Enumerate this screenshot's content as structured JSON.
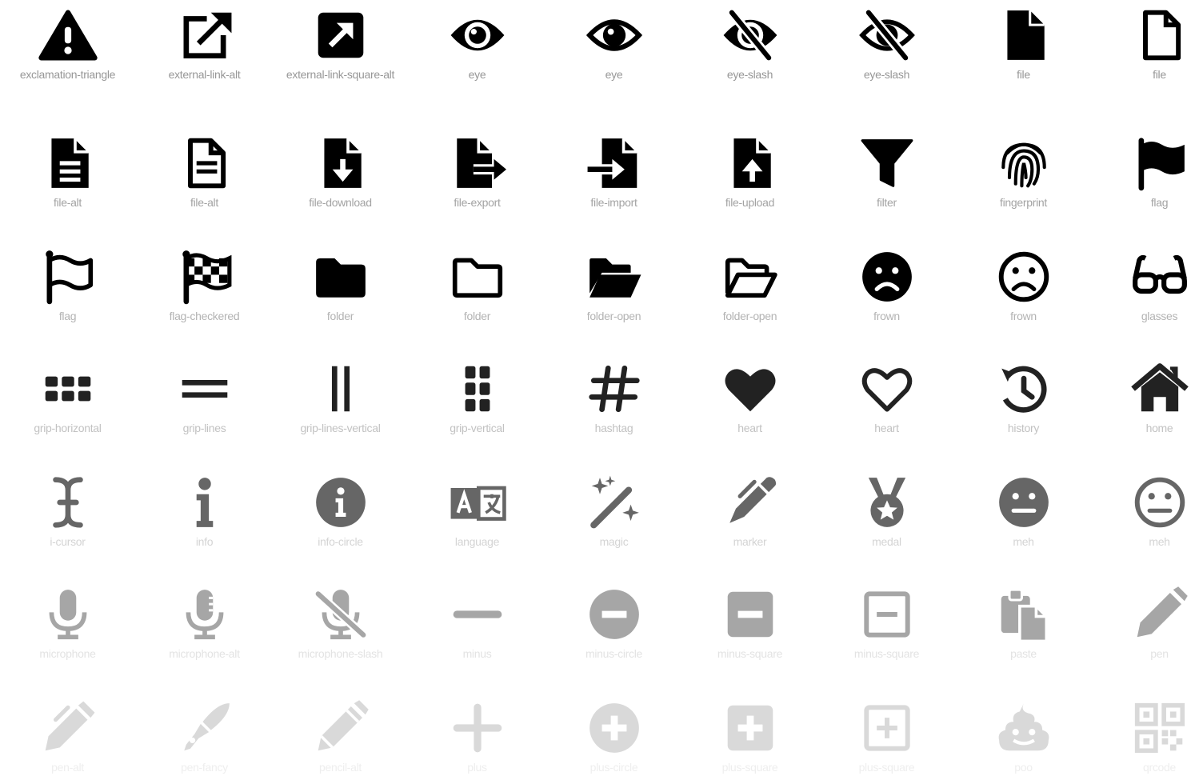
{
  "icon_grid": {
    "rows": [
      [
        {
          "icon": "exclamation-triangle-icon",
          "label": "exclamation-triangle"
        },
        {
          "icon": "external-link-alt-icon",
          "label": "external-link-alt"
        },
        {
          "icon": "external-link-square-alt-icon",
          "label": "external-link-square-alt"
        },
        {
          "icon": "eye-icon",
          "label": "eye"
        },
        {
          "icon": "eye-outline-icon",
          "label": "eye"
        },
        {
          "icon": "eye-slash-icon",
          "label": "eye-slash"
        },
        {
          "icon": "eye-slash-outline-icon",
          "label": "eye-slash"
        },
        {
          "icon": "file-icon",
          "label": "file"
        },
        {
          "icon": "file-outline-icon",
          "label": "file"
        }
      ],
      [
        {
          "icon": "file-alt-icon",
          "label": "file-alt"
        },
        {
          "icon": "file-alt-outline-icon",
          "label": "file-alt"
        },
        {
          "icon": "file-download-icon",
          "label": "file-download"
        },
        {
          "icon": "file-export-icon",
          "label": "file-export"
        },
        {
          "icon": "file-import-icon",
          "label": "file-import"
        },
        {
          "icon": "file-upload-icon",
          "label": "file-upload"
        },
        {
          "icon": "filter-icon",
          "label": "filter"
        },
        {
          "icon": "fingerprint-icon",
          "label": "fingerprint"
        },
        {
          "icon": "flag-icon",
          "label": "flag"
        }
      ],
      [
        {
          "icon": "flag-outline-icon",
          "label": "flag"
        },
        {
          "icon": "flag-checkered-icon",
          "label": "flag-checkered"
        },
        {
          "icon": "folder-icon",
          "label": "folder"
        },
        {
          "icon": "folder-outline-icon",
          "label": "folder"
        },
        {
          "icon": "folder-open-icon",
          "label": "folder-open"
        },
        {
          "icon": "folder-open-outline-icon",
          "label": "folder-open"
        },
        {
          "icon": "frown-icon",
          "label": "frown"
        },
        {
          "icon": "frown-outline-icon",
          "label": "frown"
        },
        {
          "icon": "glasses-icon",
          "label": "glasses"
        }
      ],
      [
        {
          "icon": "grip-horizontal-icon",
          "label": "grip-horizontal"
        },
        {
          "icon": "grip-lines-icon",
          "label": "grip-lines"
        },
        {
          "icon": "grip-lines-vertical-icon",
          "label": "grip-lines-vertical"
        },
        {
          "icon": "grip-vertical-icon",
          "label": "grip-vertical"
        },
        {
          "icon": "hashtag-icon",
          "label": "hashtag"
        },
        {
          "icon": "heart-icon",
          "label": "heart"
        },
        {
          "icon": "heart-outline-icon",
          "label": "heart"
        },
        {
          "icon": "history-icon",
          "label": "history"
        },
        {
          "icon": "home-icon",
          "label": "home"
        }
      ],
      [
        {
          "icon": "i-cursor-icon",
          "label": "i-cursor"
        },
        {
          "icon": "info-icon",
          "label": "info"
        },
        {
          "icon": "info-circle-icon",
          "label": "info-circle"
        },
        {
          "icon": "language-icon",
          "label": "language"
        },
        {
          "icon": "magic-icon",
          "label": "magic"
        },
        {
          "icon": "marker-icon",
          "label": "marker"
        },
        {
          "icon": "medal-icon",
          "label": "medal"
        },
        {
          "icon": "meh-icon",
          "label": "meh"
        },
        {
          "icon": "meh-outline-icon",
          "label": "meh"
        }
      ],
      [
        {
          "icon": "microphone-icon",
          "label": "microphone"
        },
        {
          "icon": "microphone-alt-icon",
          "label": "microphone-alt"
        },
        {
          "icon": "microphone-slash-icon",
          "label": "microphone-slash"
        },
        {
          "icon": "minus-icon",
          "label": "minus"
        },
        {
          "icon": "minus-circle-icon",
          "label": "minus-circle"
        },
        {
          "icon": "minus-square-icon",
          "label": "minus-square"
        },
        {
          "icon": "minus-square-outline-icon",
          "label": "minus-square"
        },
        {
          "icon": "paste-icon",
          "label": "paste"
        },
        {
          "icon": "pen-icon",
          "label": "pen"
        }
      ],
      [
        {
          "icon": "pen-alt-icon",
          "label": "pen-alt"
        },
        {
          "icon": "pen-fancy-icon",
          "label": "pen-fancy"
        },
        {
          "icon": "pencil-alt-icon",
          "label": "pencil-alt"
        },
        {
          "icon": "plus-icon",
          "label": "plus"
        },
        {
          "icon": "plus-circle-icon",
          "label": "plus-circle"
        },
        {
          "icon": "plus-square-icon",
          "label": "plus-square"
        },
        {
          "icon": "plus-square-outline-icon",
          "label": "plus-square"
        },
        {
          "icon": "poo-icon",
          "label": "poo"
        },
        {
          "icon": "qrcode-icon",
          "label": "qrcode"
        }
      ]
    ],
    "row_colors": [
      "#000000",
      "#000000",
      "#000000",
      "#222222",
      "#666666",
      "#a6a6a6",
      "#d9d9d9"
    ],
    "label_colors": [
      "#979797",
      "#a3a3a3",
      "#b3b3b3",
      "#c2c2c2",
      "#d4d4d4",
      "#e3e3e3",
      "#eeeeee"
    ]
  }
}
